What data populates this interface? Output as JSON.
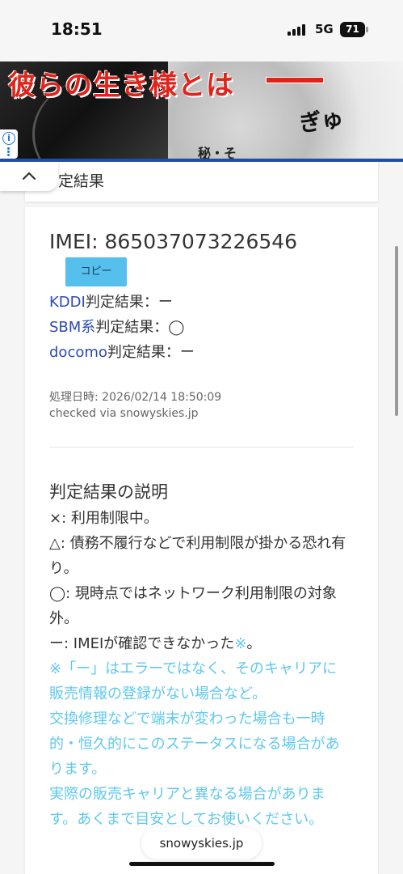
{
  "status_bar": {
    "time": "18:51",
    "network": "5G",
    "battery": "71"
  },
  "ad": {
    "headline": "彼らの生き様とは",
    "sfx": "ぎゅ",
    "caption": "秘・そ",
    "info_icon": "info-icon",
    "accent_color": "#e2231a"
  },
  "section": {
    "title": "判定結果",
    "visible_title": "定結果"
  },
  "result": {
    "imei_label": "IMEI: 865037073226546",
    "copy_label": "コピー",
    "lines": [
      {
        "carrier": "KDDI",
        "rest": "判定結果：ー"
      },
      {
        "carrier": "SBM系",
        "rest": "判定結果：◯"
      },
      {
        "carrier": "docomo",
        "rest": "判定結果：ー"
      }
    ],
    "processed_at": "処理日時: 2026/02/14 18:50:09",
    "checked_via": "checked via snowyskies.jp"
  },
  "explanation": {
    "title": "判定結果の説明",
    "lines": [
      "×: 利用制限中。",
      "△: 債務不履行などで利用制限が掛かる恐れ有り。",
      "◯: 現時点ではネットワーク利用制限の対象外。"
    ],
    "unknown_prefix": "ー: IMEIが確認できなかった",
    "note_mark": "※",
    "unknown_suffix": "。",
    "notes": [
      "※「ー」はエラーではなく、そのキャリアに販売情報の登録がない場合など。",
      "交換修理などで端末が変わった場合も一時的・恒久的にこのステータスになる場合があります。",
      "実際の販売キャリアと異なる場合があります。あくまで目安としてお使いください。"
    ],
    "note_color": "#5ec8ee",
    "link_color": "#2c4ab5"
  },
  "browser": {
    "url": "snowyskies.jp"
  }
}
